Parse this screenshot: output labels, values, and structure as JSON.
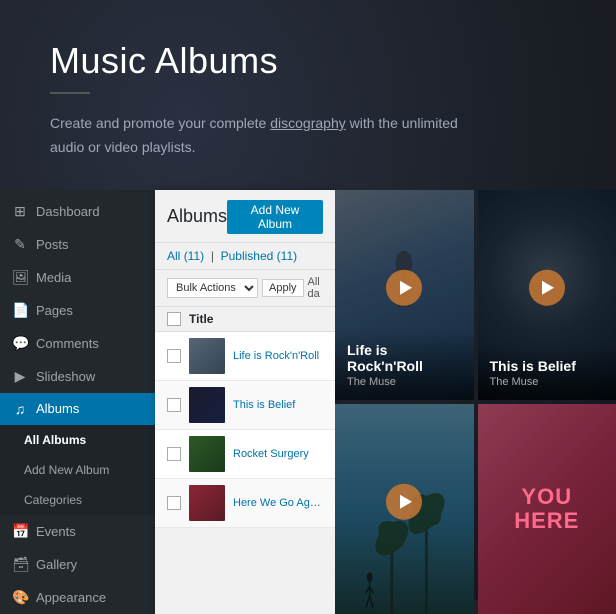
{
  "header": {
    "title": "Music Albums",
    "description_before": "Create and promote your complete ",
    "description_link": "discography",
    "description_after": " with the unlimited audio or video playlists."
  },
  "sidebar": {
    "items": [
      {
        "label": "Dashboard",
        "icon": "⊞",
        "active": false
      },
      {
        "label": "Posts",
        "icon": "✎",
        "active": false
      },
      {
        "label": "Media",
        "icon": "🖼",
        "active": false
      },
      {
        "label": "Pages",
        "icon": "📄",
        "active": false
      },
      {
        "label": "Comments",
        "icon": "💬",
        "active": false
      },
      {
        "label": "Slideshow",
        "icon": "▶",
        "active": false
      },
      {
        "label": "Albums",
        "icon": "♫",
        "active": true
      },
      {
        "label": "All Albums",
        "sub": true,
        "active_sub": true
      },
      {
        "label": "Add New Album",
        "sub": true
      },
      {
        "label": "Categories",
        "sub": true
      },
      {
        "label": "Events",
        "icon": "📅",
        "active": false
      },
      {
        "label": "Gallery",
        "icon": "🗃",
        "active": false
      },
      {
        "label": "Appearance",
        "icon": "🎨",
        "active": false
      }
    ]
  },
  "admin_panel": {
    "title": "Albums",
    "add_new_label": "Add New Album",
    "filter": {
      "all_label": "All",
      "all_count": "(11)",
      "published_label": "Published",
      "published_count": "(11)"
    },
    "bulk_actions": {
      "label": "Bulk Actions",
      "apply_label": "Apply",
      "all_dates_label": "All da"
    },
    "table_col": "Title",
    "albums": [
      {
        "name": "Life is Rock'n'Roll",
        "thumb_class": "thumb-rocknroll"
      },
      {
        "name": "This is Belief",
        "thumb_class": "thumb-belief"
      },
      {
        "name": "Rocket Surgery",
        "thumb_class": "thumb-surgery"
      },
      {
        "name": "Here We Go Again",
        "thumb_class": "thumb-here"
      }
    ]
  },
  "cards": [
    {
      "id": "rocknroll",
      "title": "Life is Rock'n'Roll",
      "subtitle": "The Muse",
      "has_play": true,
      "style": "card-rocknroll"
    },
    {
      "id": "belief",
      "title": "This is Belief",
      "subtitle": "The Muse",
      "has_play": true,
      "style": "card-belief"
    },
    {
      "id": "palmtrees",
      "title": "",
      "subtitle": "",
      "has_play": true,
      "style": "palm-card"
    },
    {
      "id": "youhere",
      "title": "",
      "subtitle": "",
      "has_play": false,
      "style": "card-you-here",
      "you_here_text": "You\nHere"
    }
  ]
}
